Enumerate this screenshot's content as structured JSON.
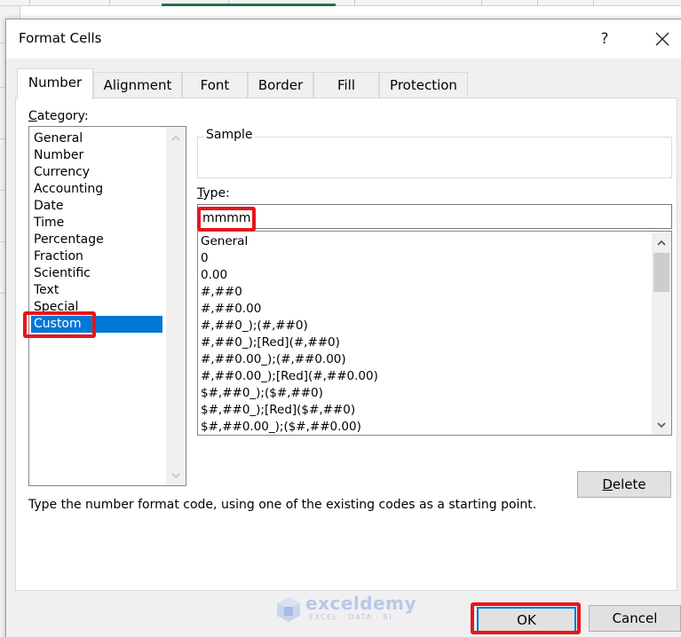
{
  "dialog": {
    "title": "Format Cells",
    "help_label": "?",
    "close_label": "close"
  },
  "tabs": [
    {
      "label": "Number",
      "active": true
    },
    {
      "label": "Alignment",
      "active": false
    },
    {
      "label": "Font",
      "active": false
    },
    {
      "label": "Border",
      "active": false
    },
    {
      "label": "Fill",
      "active": false
    },
    {
      "label": "Protection",
      "active": false
    }
  ],
  "category": {
    "label_accel": "C",
    "label_rest": "ategory:",
    "items": [
      "General",
      "Number",
      "Currency",
      "Accounting",
      "Date",
      "Time",
      "Percentage",
      "Fraction",
      "Scientific",
      "Text",
      "Special",
      "Custom"
    ],
    "selected": "Custom"
  },
  "sample": {
    "label": "Sample",
    "value": ""
  },
  "type": {
    "label_accel": "T",
    "label_rest": "ype:",
    "value": "mmmm",
    "items": [
      "General",
      "0",
      "0.00",
      "#,##0",
      "#,##0.00",
      "#,##0_);(#,##0)",
      "#,##0_);[Red](#,##0)",
      "#,##0.00_);(#,##0.00)",
      "#,##0.00_);[Red](#,##0.00)",
      "$#,##0_);($#,##0)",
      "$#,##0_);[Red]($#,##0)",
      "$#,##0.00_);($#,##0.00)"
    ]
  },
  "buttons": {
    "delete_accel": "D",
    "delete_rest": "elete",
    "ok": "OK",
    "cancel": "Cancel"
  },
  "hint": "Type the number format code, using one of the existing codes as a starting point.",
  "watermark": {
    "brand": "exceldemy",
    "tagline": "EXCEL · DATA · BI"
  },
  "colors": {
    "selection": "#0078d7",
    "highlight_annotation": "#e8141c",
    "excel_green": "#217346"
  }
}
